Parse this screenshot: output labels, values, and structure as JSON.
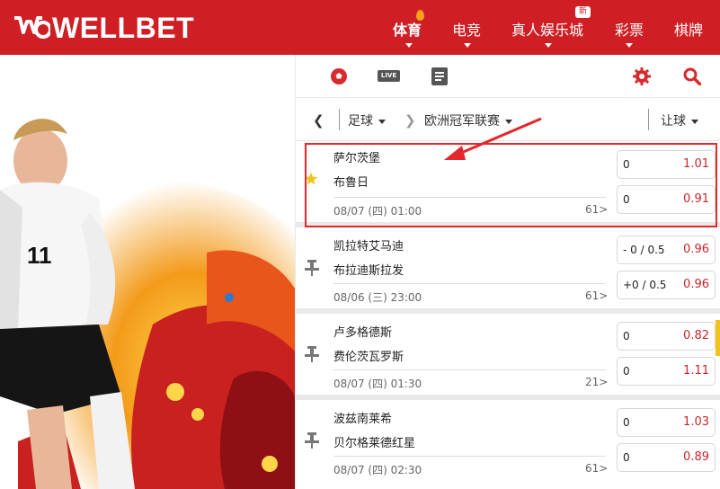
{
  "brand": {
    "logo_text": "WELLBET"
  },
  "nav": {
    "items": [
      {
        "label": "体育",
        "active": true
      },
      {
        "label": "电竞"
      },
      {
        "label": "真人娱乐城"
      },
      {
        "label": "彩票"
      },
      {
        "label": "棋牌"
      }
    ],
    "new_badge": "新"
  },
  "panel": {
    "tabs": [
      "soccer-ball-icon",
      "live-icon",
      "list-icon"
    ],
    "live_label": "LIVE",
    "filter": {
      "sport": "足球",
      "league": "欧洲冠军联赛",
      "market": "让球"
    }
  },
  "matches": [
    {
      "home": "萨尔茨堡",
      "away": "布鲁日",
      "date": "08/07 (四) 01:00",
      "count": "61>",
      "odds": [
        {
          "hc": "0",
          "v": "1.01"
        },
        {
          "hc": "0",
          "v": "0.91"
        }
      ],
      "pinned": true
    },
    {
      "home": "凯拉特艾马迪",
      "away": "布拉迪斯拉发",
      "date": "08/06 (三) 23:00",
      "count": "61>",
      "odds": [
        {
          "hc": "- 0 / 0.5",
          "v": "0.96"
        },
        {
          "hc": "+0 / 0.5",
          "v": "0.96"
        }
      ],
      "pinned": false
    },
    {
      "home": "卢多格德斯",
      "away": "费伦茨瓦罗斯",
      "date": "08/07 (四) 01:30",
      "count": "21>",
      "odds": [
        {
          "hc": "0",
          "v": "0.82"
        },
        {
          "hc": "0",
          "v": "1.11"
        }
      ],
      "pinned": false
    },
    {
      "home": "波兹南莱希",
      "away": "贝尔格莱德红星",
      "date": "08/07 (四) 02:30",
      "count": "61>",
      "odds": [
        {
          "hc": "0",
          "v": "1.03"
        },
        {
          "hc": "0",
          "v": "0.89"
        }
      ],
      "pinned": false
    }
  ],
  "colors": {
    "brand_red": "#cf1f24",
    "odds_red": "#c8252a",
    "star": "#f0c419"
  }
}
